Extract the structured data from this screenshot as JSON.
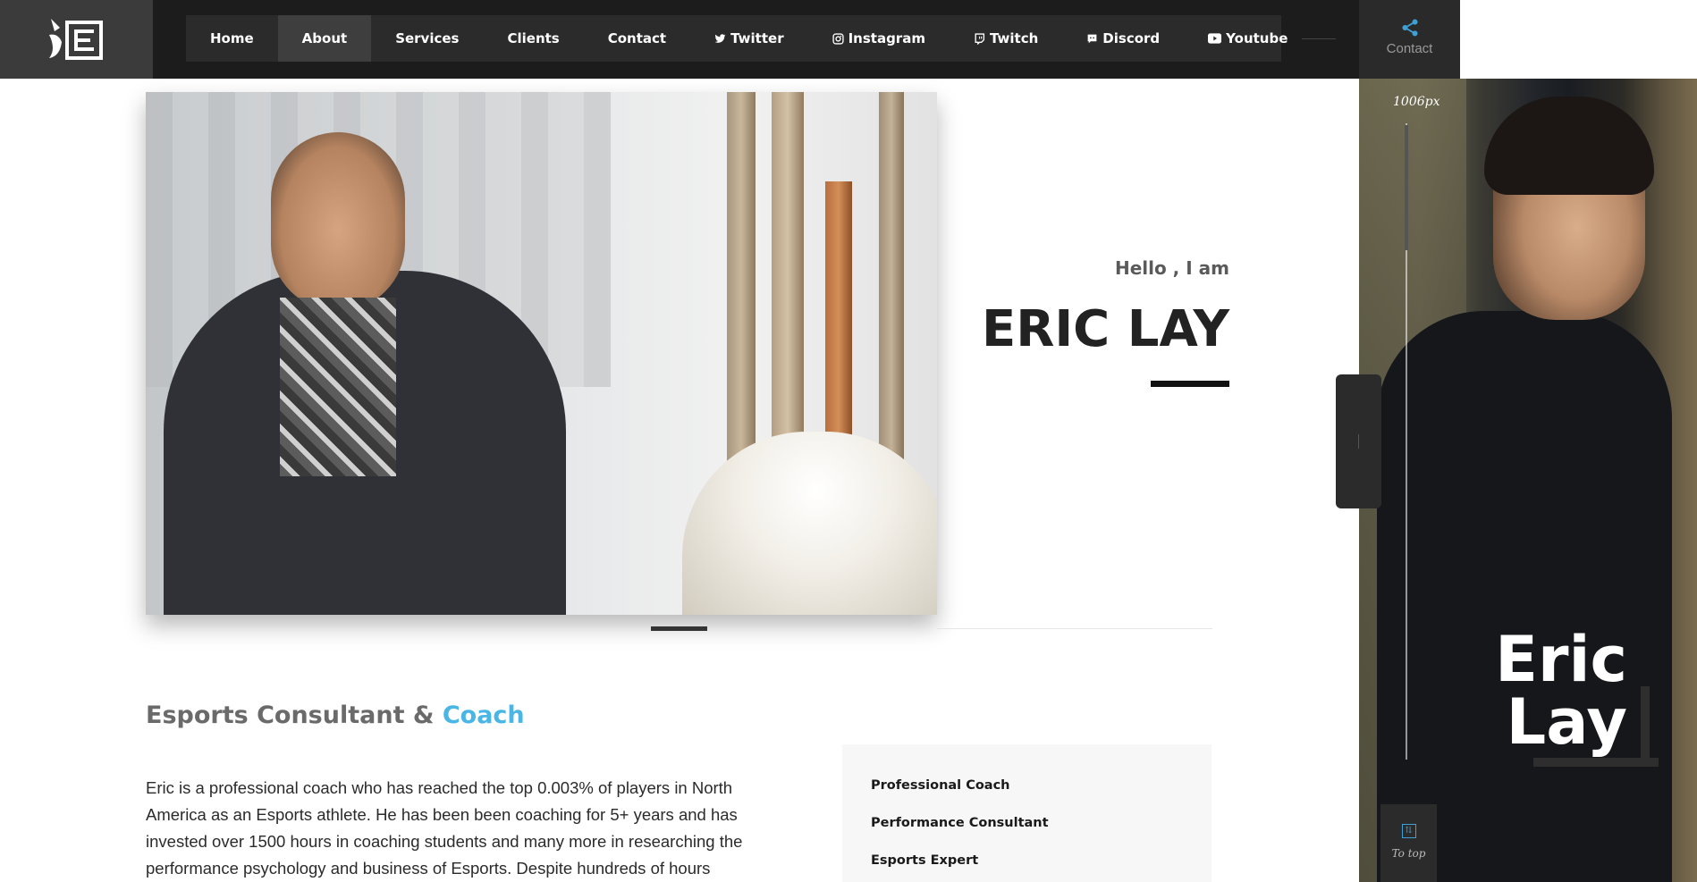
{
  "nav": {
    "items": [
      {
        "label": "Home",
        "icon": ""
      },
      {
        "label": "About",
        "icon": "",
        "active": true
      },
      {
        "label": "Services",
        "icon": ""
      },
      {
        "label": "Clients",
        "icon": ""
      },
      {
        "label": "Contact",
        "icon": ""
      },
      {
        "label": "Twitter",
        "icon": "twitter-icon"
      },
      {
        "label": "Instagram",
        "icon": "instagram-icon"
      },
      {
        "label": "Twitch",
        "icon": "twitch-icon"
      },
      {
        "label": "Discord",
        "icon": "discord-icon"
      },
      {
        "label": "Youtube",
        "icon": "youtube-icon"
      }
    ]
  },
  "contact": {
    "label": "Contact",
    "icon": "share-icon"
  },
  "side_panel": {
    "scale_label": "1006px",
    "name_line1": "Eric",
    "name_line2": "Lay",
    "to_top_label": "To top"
  },
  "hero": {
    "greeting": "Hello , I am",
    "name": "ERIC LAY"
  },
  "about": {
    "title_main": "Esports Consultant & ",
    "title_accent": "Coach",
    "bio": "Eric is a professional coach who has reached the top 0.003% of players in North America as an Esports athlete. He has been been coaching for 5+ years and has invested over 1500 hours in coaching students and many more in researching the performance psychology and business of Esports. Despite hundreds of hours",
    "roles": [
      "Professional Coach",
      "Performance Consultant",
      "Esports Expert"
    ]
  },
  "colors": {
    "accent": "#4ab6e6",
    "topbar": "#1c1c1c",
    "nav_bg": "#2b2b2b"
  }
}
